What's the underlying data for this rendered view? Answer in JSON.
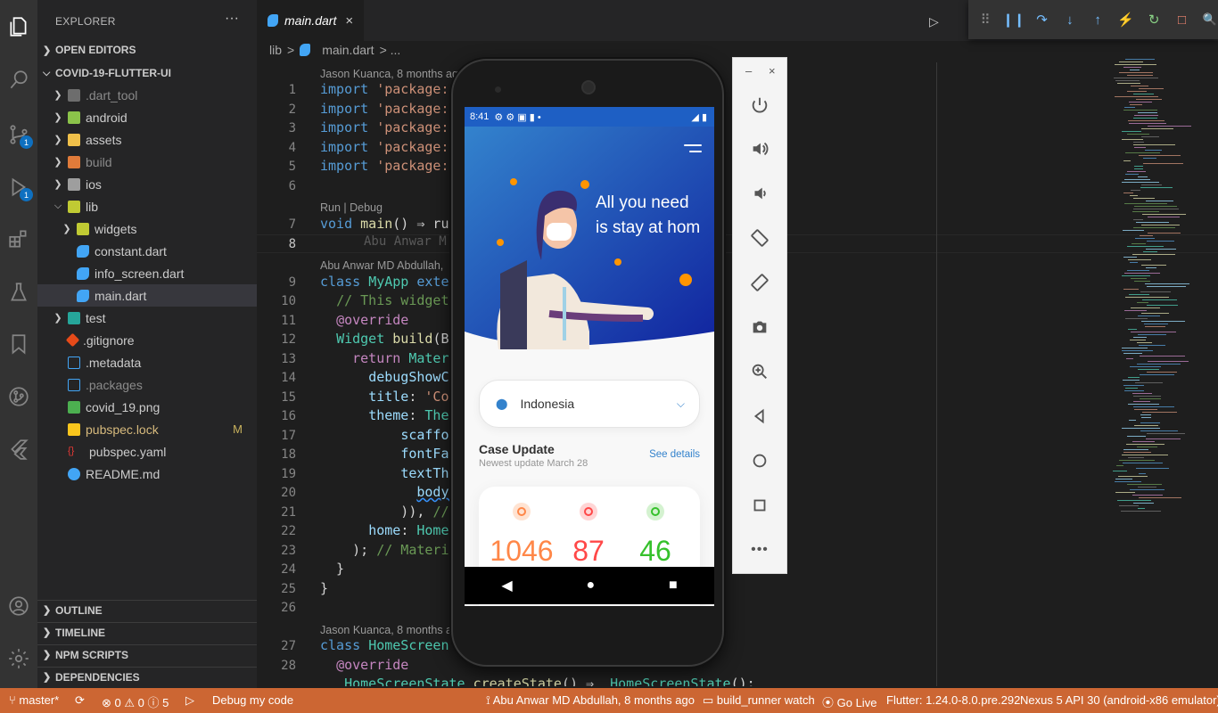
{
  "activity_bar": {
    "icons": [
      "explorer-icon",
      "search-icon",
      "source-control-icon",
      "run-debug-icon",
      "extensions-icon",
      "testing-icon",
      "bookmarks-icon",
      "git-graph-icon",
      "flutter-icon",
      "account-icon",
      "settings-icon"
    ],
    "source_control_badge": "1",
    "debug_badge": "1"
  },
  "sidebar": {
    "title": "EXPLORER",
    "more": "···",
    "open_editors": "OPEN EDITORS",
    "project": "COVID-19-FLUTTER-UI",
    "tree": [
      {
        "label": ".dart_tool",
        "dim": true
      },
      {
        "label": "android"
      },
      {
        "label": "assets"
      },
      {
        "label": "build",
        "dim": true
      },
      {
        "label": "ios"
      },
      {
        "label": "lib"
      },
      {
        "label": "widgets"
      },
      {
        "label": "constant.dart"
      },
      {
        "label": "info_screen.dart"
      },
      {
        "label": "main.dart"
      },
      {
        "label": "test"
      },
      {
        "label": ".gitignore"
      },
      {
        "label": ".metadata"
      },
      {
        "label": ".packages",
        "dim": true
      },
      {
        "label": "covid_19.png"
      },
      {
        "label": "pubspec.lock",
        "badge": "M"
      },
      {
        "label": "pubspec.yaml"
      },
      {
        "label": "README.md"
      }
    ],
    "sections": [
      "OUTLINE",
      "TIMELINE",
      "NPM SCRIPTS",
      "DEPENDENCIES"
    ]
  },
  "editor": {
    "tab": "main.dart",
    "tab_close": "×",
    "breadcrumb": [
      "lib",
      ">",
      "main.dart",
      "> ..."
    ],
    "lens": {
      "l1": "Jason Kuanca, 8 months ag",
      "run": "Run | Debug",
      "l9": "Abu Anwar MD Abdullah,",
      "l27": "Jason Kuanca, 8 months a"
    },
    "ghost_text": "Abu Anwar M",
    "line_numbers": [
      "1",
      "2",
      "3",
      "4",
      "5",
      "6",
      "7",
      "8",
      "9",
      "10",
      "11",
      "12",
      "13",
      "14",
      "15",
      "16",
      "17",
      "18",
      "19",
      "20",
      "21",
      "22",
      "23",
      "24",
      "25",
      "26",
      "27",
      "28"
    ]
  },
  "debug_toolbar": [
    "⠿",
    "❙❙",
    "↷",
    "↓",
    "↑",
    "⚡",
    "↻",
    "□",
    "🔍"
  ],
  "emulator": {
    "time": "8:41",
    "hero_line1": "All you need",
    "hero_line2": "is stay at hom",
    "location": "Indonesia",
    "case_title": "Case Update",
    "case_sub": "Newest update March 28",
    "see_details": "See details",
    "stats": [
      {
        "value": "1046",
        "color": "#ff8748"
      },
      {
        "value": "87",
        "color": "#ff4848"
      },
      {
        "value": "46",
        "color": "#36c12c"
      }
    ],
    "panel_close": "×",
    "panel_min": "–"
  },
  "statusbar": {
    "branch": "master*",
    "problems": "⊗ 0 ⚠ 0 ⓘ 5",
    "debug": "Debug my code",
    "blame": "Abu Anwar MD Abdullah, 8 months ago",
    "build_runner": "build_runner watch",
    "go_live": "Go Live",
    "flutter": "Flutter: 1.24.0-8.0.pre.292",
    "device": "Nexus 5 API 30 (android-x86 emulator)"
  },
  "colors": {
    "status_bg": "#cc6633",
    "accent_blue": "#3382cc",
    "hero_blue": "#1e5fc4"
  }
}
